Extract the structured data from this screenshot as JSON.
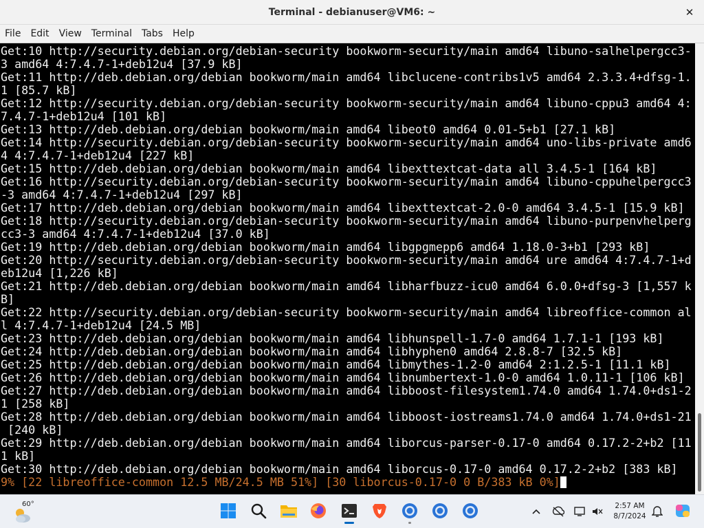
{
  "window": {
    "title": "Terminal - debianuser@VM6: ~",
    "close_glyph": "✕"
  },
  "menu": [
    "File",
    "Edit",
    "View",
    "Terminal",
    "Tabs",
    "Help"
  ],
  "terminal": {
    "lines": [
      "Get:10 http://security.debian.org/debian-security bookworm-security/main amd64 libuno-salhelpergcc3-",
      "3 amd64 4:7.4.7-1+deb12u4 [37.9 kB]",
      "Get:11 http://deb.debian.org/debian bookworm/main amd64 libclucene-contribs1v5 amd64 2.3.3.4+dfsg-1.",
      "1 [85.7 kB]",
      "Get:12 http://security.debian.org/debian-security bookworm-security/main amd64 libuno-cppu3 amd64 4:",
      "7.4.7-1+deb12u4 [101 kB]",
      "Get:13 http://deb.debian.org/debian bookworm/main amd64 libeot0 amd64 0.01-5+b1 [27.1 kB]",
      "Get:14 http://security.debian.org/debian-security bookworm-security/main amd64 uno-libs-private amd6",
      "4 4:7.4.7-1+deb12u4 [227 kB]",
      "Get:15 http://deb.debian.org/debian bookworm/main amd64 libexttextcat-data all 3.4.5-1 [164 kB]",
      "Get:16 http://security.debian.org/debian-security bookworm-security/main amd64 libuno-cppuhelpergcc3",
      "-3 amd64 4:7.4.7-1+deb12u4 [297 kB]",
      "Get:17 http://deb.debian.org/debian bookworm/main amd64 libexttextcat-2.0-0 amd64 3.4.5-1 [15.9 kB]",
      "Get:18 http://security.debian.org/debian-security bookworm-security/main amd64 libuno-purpenvhelperg",
      "cc3-3 amd64 4:7.4.7-1+deb12u4 [37.0 kB]",
      "Get:19 http://deb.debian.org/debian bookworm/main amd64 libgpgmepp6 amd64 1.18.0-3+b1 [293 kB]",
      "Get:20 http://security.debian.org/debian-security bookworm-security/main amd64 ure amd64 4:7.4.7-1+d",
      "eb12u4 [1,226 kB]",
      "Get:21 http://deb.debian.org/debian bookworm/main amd64 libharfbuzz-icu0 amd64 6.0.0+dfsg-3 [1,557 k",
      "B]",
      "Get:22 http://security.debian.org/debian-security bookworm-security/main amd64 libreoffice-common al",
      "l 4:7.4.7-1+deb12u4 [24.5 MB]",
      "Get:23 http://deb.debian.org/debian bookworm/main amd64 libhunspell-1.7-0 amd64 1.7.1-1 [193 kB]",
      "Get:24 http://deb.debian.org/debian bookworm/main amd64 libhyphen0 amd64 2.8.8-7 [32.5 kB]",
      "Get:25 http://deb.debian.org/debian bookworm/main amd64 libmythes-1.2-0 amd64 2:1.2.5-1 [11.1 kB]",
      "Get:26 http://deb.debian.org/debian bookworm/main amd64 libnumbertext-1.0-0 amd64 1.0.11-1 [106 kB]",
      "Get:27 http://deb.debian.org/debian bookworm/main amd64 libboost-filesystem1.74.0 amd64 1.74.0+ds1-2",
      "1 [258 kB]",
      "Get:28 http://deb.debian.org/debian bookworm/main amd64 libboost-iostreams1.74.0 amd64 1.74.0+ds1-21",
      " [240 kB]",
      "Get:29 http://deb.debian.org/debian bookworm/main amd64 liborcus-parser-0.17-0 amd64 0.17.2-2+b2 [11",
      "1 kB]",
      "Get:30 http://deb.debian.org/debian bookworm/main amd64 liborcus-0.17-0 amd64 0.17.2-2+b2 [383 kB]"
    ],
    "status_line": "9% [22 libreoffice-common 12.5 MB/24.5 MB 51%] [30 liborcus-0.17-0 0 B/383 kB 0%]",
    "colors": {
      "background": "#000000",
      "text": "#f0f0f0",
      "status": "#c7702e"
    }
  },
  "scrollbar": {
    "position_fraction": 0.82
  },
  "taskbar": {
    "weather": {
      "temp": "60°",
      "icon": "partly-cloudy-icon"
    },
    "apps": [
      {
        "name": "windows-start-icon"
      },
      {
        "name": "search-icon"
      },
      {
        "name": "file-explorer-icon"
      },
      {
        "name": "firefox-icon"
      },
      {
        "name": "terminal-app-icon",
        "active": true
      },
      {
        "name": "brave-icon"
      },
      {
        "name": "chrome-icon-1",
        "open": true
      },
      {
        "name": "chrome-icon-2"
      },
      {
        "name": "chrome-icon-3"
      }
    ],
    "tray": [
      "chevron-up-icon",
      "network-icon",
      "display-icon",
      "volume-icon"
    ],
    "clock": {
      "time": "2:57 AM",
      "date": "8/7/2024"
    },
    "accent": "#0067c0"
  }
}
